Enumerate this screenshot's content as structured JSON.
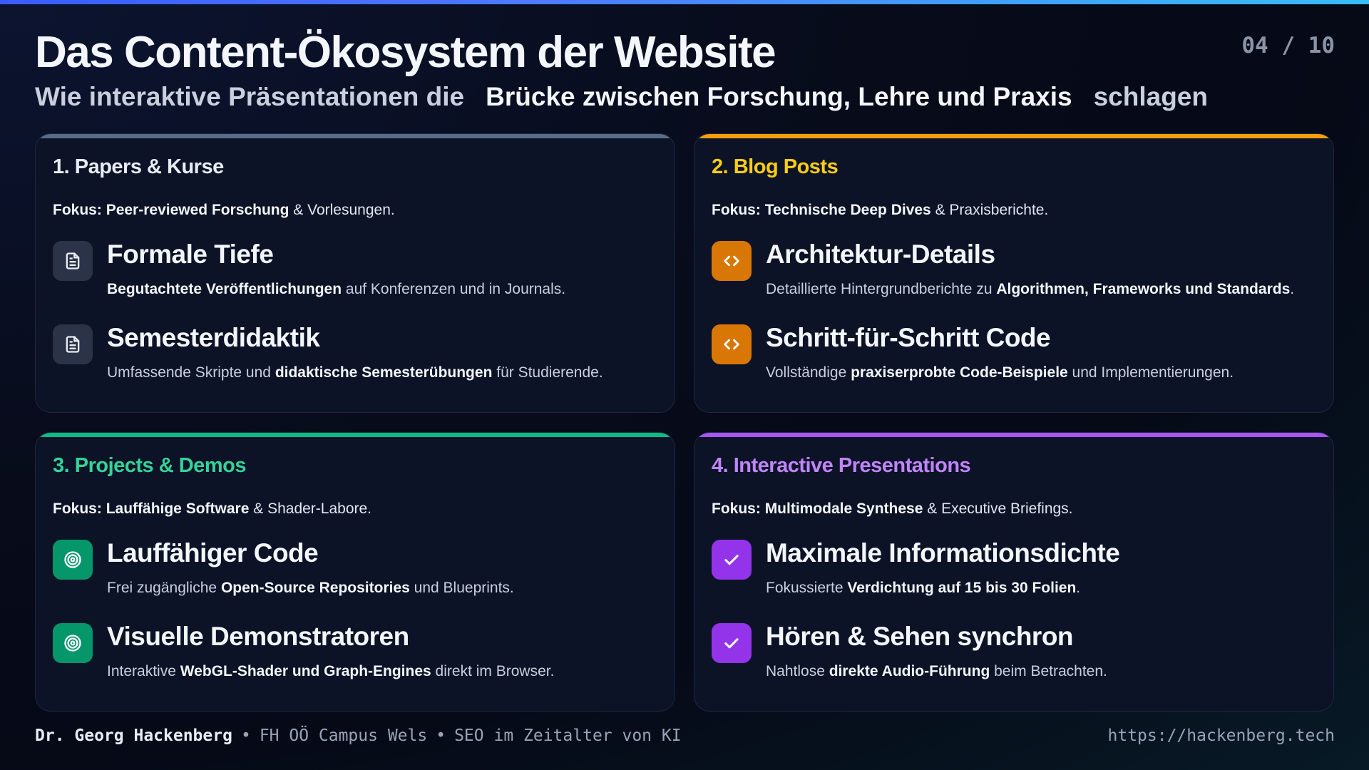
{
  "header": {
    "title": "Das Content-Ökosystem der Website",
    "page_number": "04 / 10",
    "subtitle_pre": "Wie interaktive Präsentationen die",
    "subtitle_highlight": "Brücke zwischen Forschung, Lehre und Praxis",
    "subtitle_post": "schlagen"
  },
  "colors": {
    "card1_accent": "#5b6b87",
    "card2_accent": "#f59e0b",
    "card3_accent": "#10b981",
    "card4_accent": "#a855f7"
  },
  "cards": [
    {
      "title": "1. Papers & Kurse",
      "focus_label": "Fokus:",
      "focus_bold": "Peer-reviewed Forschung",
      "focus_rest": "& Vorlesungen.",
      "features": [
        {
          "icon": "document-icon",
          "title": "Formale Tiefe",
          "desc_pre": "",
          "desc_bold": "Begutachtete Veröffentlichungen",
          "desc_post": "auf Konferenzen und in Journals."
        },
        {
          "icon": "document-icon",
          "title": "Semesterdidaktik",
          "desc_pre": "Umfassende Skripte und",
          "desc_bold": "didaktische Semesterübungen",
          "desc_post": "für Studierende."
        }
      ]
    },
    {
      "title": "2. Blog Posts",
      "focus_label": "Fokus:",
      "focus_bold": "Technische Deep Dives",
      "focus_rest": "& Praxisberichte.",
      "features": [
        {
          "icon": "code-icon",
          "title": "Architektur-Details",
          "desc_pre": "Detaillierte Hintergrundberichte zu",
          "desc_bold": "Algorithmen, Frameworks und Standards",
          "desc_post": "."
        },
        {
          "icon": "code-icon",
          "title": "Schritt-für-Schritt Code",
          "desc_pre": "Vollständige",
          "desc_bold": "praxiserprobte Code-Beispiele",
          "desc_post": "und Implementierungen."
        }
      ]
    },
    {
      "title": "3. Projects & Demos",
      "focus_label": "Fokus:",
      "focus_bold": "Lauffähige Software",
      "focus_rest": "& Shader-Labore.",
      "features": [
        {
          "icon": "target-icon",
          "title": "Lauffähiger Code",
          "desc_pre": "Frei zugängliche",
          "desc_bold": "Open-Source Repositories",
          "desc_post": "und Blueprints."
        },
        {
          "icon": "target-icon",
          "title": "Visuelle Demonstratoren",
          "desc_pre": "Interaktive",
          "desc_bold": "WebGL-Shader und Graph-Engines",
          "desc_post": "direkt im Browser."
        }
      ]
    },
    {
      "title": "4. Interactive Presentations",
      "focus_label": "Fokus:",
      "focus_bold": "Multimodale Synthese",
      "focus_rest": "& Executive Briefings.",
      "features": [
        {
          "icon": "check-icon",
          "title": "Maximale Informationsdichte",
          "desc_pre": "Fokussierte",
          "desc_bold": "Verdichtung auf 15 bis 30 Folien",
          "desc_post": "."
        },
        {
          "icon": "check-icon",
          "title": "Hören & Sehen synchron",
          "desc_pre": "Nahtlose",
          "desc_bold": "direkte Audio-Führung",
          "desc_post": "beim Betrachten."
        }
      ]
    }
  ],
  "footer": {
    "author": "Dr. Georg Hackenberg",
    "separator": "•",
    "institution": "FH OÖ Campus Wels",
    "topic": "SEO im Zeitalter von KI",
    "url": "https://hackenberg.tech"
  }
}
